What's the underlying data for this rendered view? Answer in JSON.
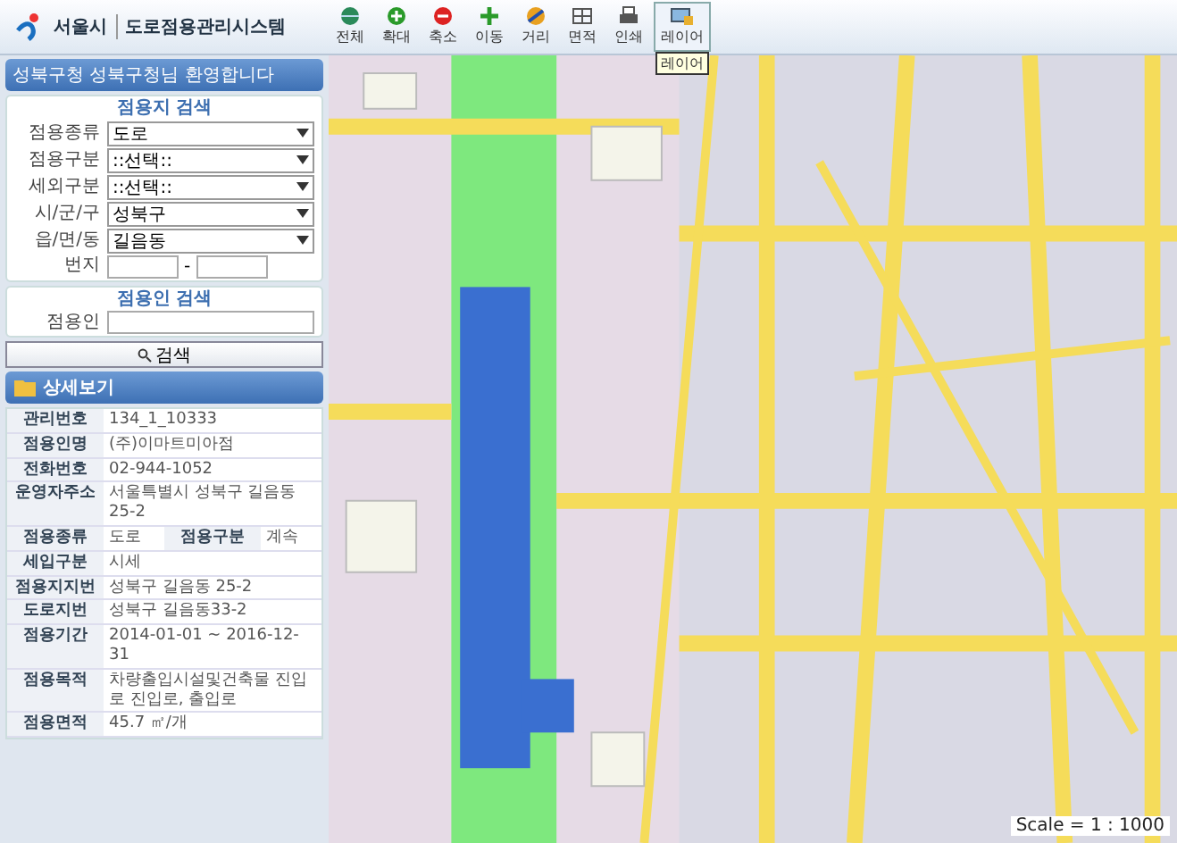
{
  "header": {
    "logo_text": "서울시",
    "system_title": "도로점용관리시스템"
  },
  "toolbar": [
    {
      "label": "전체",
      "selected": false
    },
    {
      "label": "확대",
      "selected": false
    },
    {
      "label": "축소",
      "selected": false
    },
    {
      "label": "이동",
      "selected": false
    },
    {
      "label": "거리",
      "selected": false
    },
    {
      "label": "면적",
      "selected": false
    },
    {
      "label": "인쇄",
      "selected": false
    },
    {
      "label": "레이어",
      "selected": true
    }
  ],
  "tooltip": "레이어",
  "welcome": "성북구청 성북구청님 환영합니다",
  "site_search": {
    "title": "점용지 검색",
    "fields": [
      {
        "label": "점용종류",
        "kind": "select",
        "value": "도로"
      },
      {
        "label": "점용구분",
        "kind": "select",
        "value": "::선택::"
      },
      {
        "label": "세외구분",
        "kind": "select",
        "value": "::선택::"
      },
      {
        "label": "시/군/구",
        "kind": "select",
        "value": "성북구"
      },
      {
        "label": "읍/면/동",
        "kind": "select",
        "value": "길음동"
      },
      {
        "label": "번지",
        "kind": "range",
        "separator": "-"
      }
    ]
  },
  "occupant_search": {
    "title": "점용인 검색",
    "label": "점용인"
  },
  "search_button": "검색",
  "detail": {
    "title": "상세보기",
    "rows": [
      {
        "cells": [
          {
            "label": "관리번호",
            "value": "134_1_10333"
          }
        ]
      },
      {
        "cells": [
          {
            "label": "점용인명",
            "value": "(주)이마트미아점"
          }
        ]
      },
      {
        "cells": [
          {
            "label": "전화번호",
            "value": "02-944-1052"
          }
        ]
      },
      {
        "cells": [
          {
            "label": "운영자주소",
            "value": "서울특별시 성북구 길음동 25-2"
          }
        ]
      },
      {
        "cells": [
          {
            "label": "점용종류",
            "value": "도로"
          },
          {
            "label": "점용구분",
            "value": "계속"
          }
        ]
      },
      {
        "cells": [
          {
            "label": "세입구분",
            "value": "시세"
          }
        ]
      },
      {
        "cells": [
          {
            "label": "점용지지번",
            "value": "성북구 길음동 25-2"
          }
        ]
      },
      {
        "cells": [
          {
            "label": "도로지번",
            "value": "성북구 길음동33-2"
          }
        ]
      },
      {
        "cells": [
          {
            "label": "점용기간",
            "value": "2014-01-01 ~ 2016-12-31"
          }
        ]
      },
      {
        "cells": [
          {
            "label": "점용목적",
            "value": "차량출입시설및건축물 진입로 진입로, 출입로"
          }
        ]
      },
      {
        "cells": [
          {
            "label": "점용면적",
            "value": "45.7 ㎡/개"
          }
        ]
      }
    ]
  },
  "map": {
    "scale": "Scale = 1 : 1000"
  }
}
